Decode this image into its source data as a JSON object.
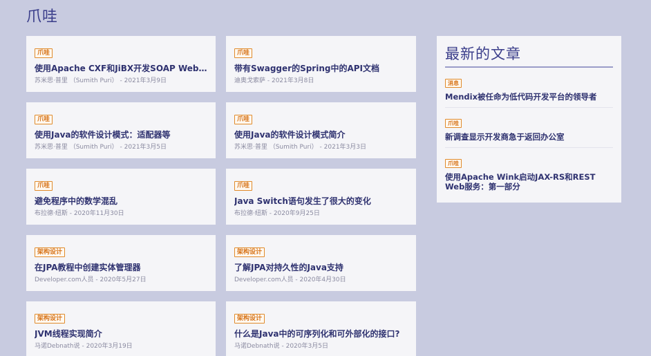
{
  "header": {
    "title": "爪哇"
  },
  "articles": [
    {
      "tag": "爪哇",
      "title": "使用Apache CXF和JiBX开发SOAP Web服务",
      "meta": "苏米思·普里 （Sumith Puri） - 2021年3月9日"
    },
    {
      "tag": "爪哇",
      "title": "带有Swagger的Spring中的API文档",
      "meta": "迪奥戈索萨 - 2021年3月8日"
    },
    {
      "tag": "爪哇",
      "title": "使用Java的软件设计模式：适配器等",
      "meta": "苏米思·普里 （Sumith Puri） - 2021年3月5日"
    },
    {
      "tag": "爪哇",
      "title": "使用Java的软件设计模式简介",
      "meta": "苏米思·普里 （Sumith Puri） - 2021年3月3日"
    },
    {
      "tag": "爪哇",
      "title": "避免程序中的数学混乱",
      "meta": "布拉德·纽斯 - 2020年11月30日"
    },
    {
      "tag": "爪哇",
      "title": "Java Switch语句发生了很大的变化",
      "meta": "布拉德·纽斯 - 2020年9月25日"
    },
    {
      "tag": "架构设计",
      "title": "在JPA教程中创建实体管理器",
      "meta": "Developer.com人员 - 2020年5月27日"
    },
    {
      "tag": "架构设计",
      "title": "了解JPA对持久性的Java支持",
      "meta": "Developer.com人员 - 2020年4月30日"
    },
    {
      "tag": "架构设计",
      "title": "JVM线程实现简介",
      "meta": "马诺Debnath说 - 2020年3月19日"
    },
    {
      "tag": "架构设计",
      "title": "什么是Java中的可序列化和可外部化的接口?",
      "meta": "马诺Debnath说 - 2020年3月5日"
    }
  ],
  "sidebar": {
    "title": "最新的文章",
    "items": [
      {
        "tag": "消息",
        "title": "Mendix被任命为低代码开发平台的领导者"
      },
      {
        "tag": "爪哇",
        "title": "新调查显示开发商急于返回办公室"
      },
      {
        "tag": "爪哇",
        "title": "使用Apache Wink启动JAX-RS和REST Web服务：第一部分"
      }
    ]
  }
}
